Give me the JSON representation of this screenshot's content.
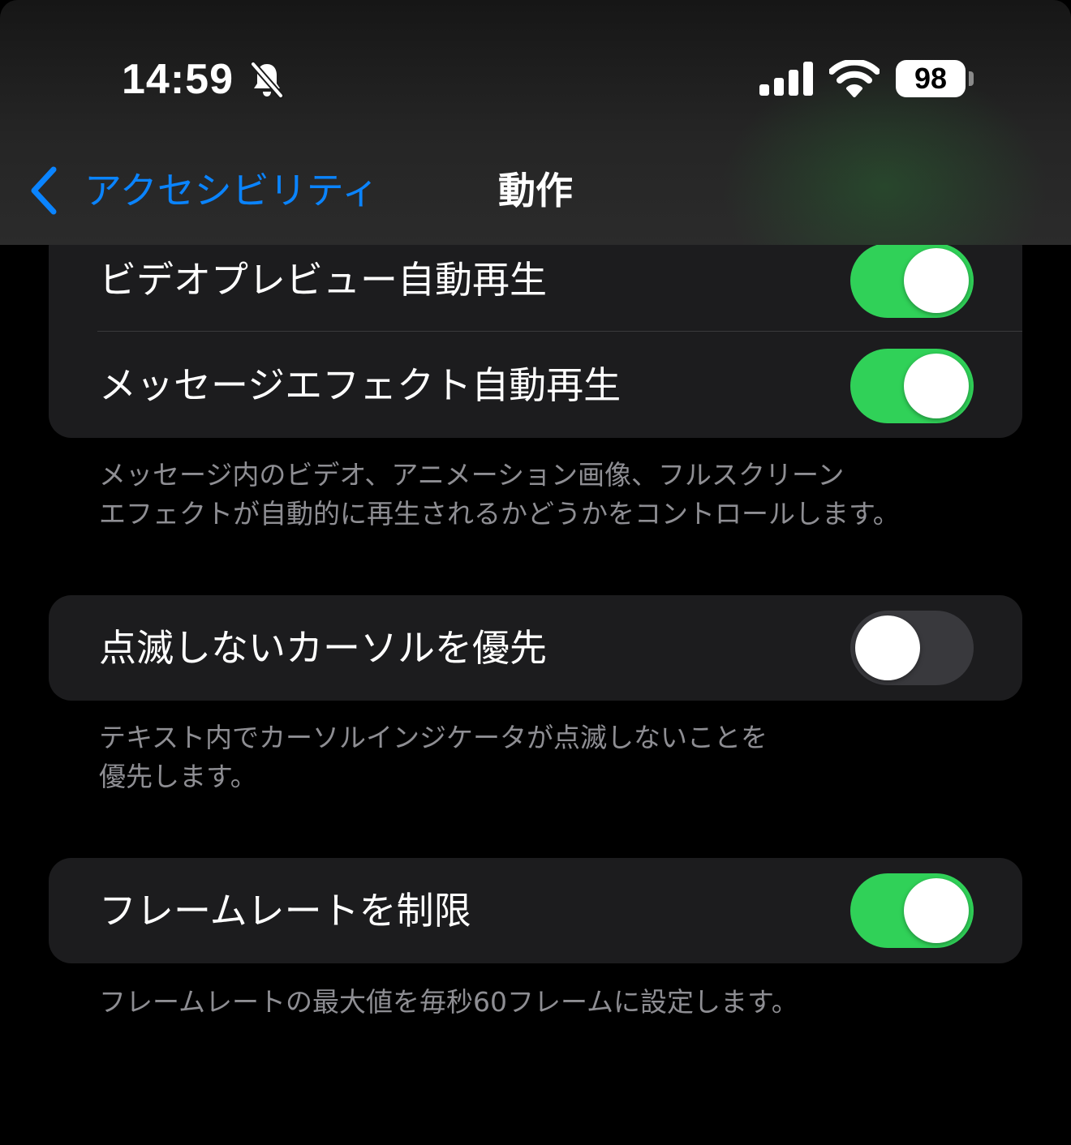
{
  "status_bar": {
    "time": "14:59",
    "battery_level": "98",
    "icons": [
      "bell-slash-icon",
      "signal-icon",
      "wifi-icon",
      "battery-icon"
    ]
  },
  "nav": {
    "back_label": "アクセシビリティ",
    "title": "動作"
  },
  "colors": {
    "accent": "#0a84ff",
    "toggle_on": "#30d158",
    "toggle_off": "#39393d",
    "group_background": "#1c1c1e",
    "secondary_text": "#8e8e93"
  },
  "groups": [
    {
      "rows": [
        {
          "label": "ビデオプレビュー自動再生",
          "toggle": true
        },
        {
          "label": "メッセージエフェクト自動再生",
          "toggle": true
        }
      ],
      "footer": [
        "メッセージ内のビデオ、アニメーション画像、フルスクリーン",
        "エフェクトが自動的に再生されるかどうかをコントロールします。"
      ]
    },
    {
      "rows": [
        {
          "label": "点滅しないカーソルを優先",
          "toggle": false
        }
      ],
      "footer": [
        "テキスト内でカーソルインジケータが点滅しないことを",
        "優先します。"
      ]
    },
    {
      "rows": [
        {
          "label": "フレームレートを制限",
          "toggle": true
        }
      ],
      "footer": [
        "フレームレートの最大値を毎秒60フレームに設定します。"
      ]
    }
  ]
}
